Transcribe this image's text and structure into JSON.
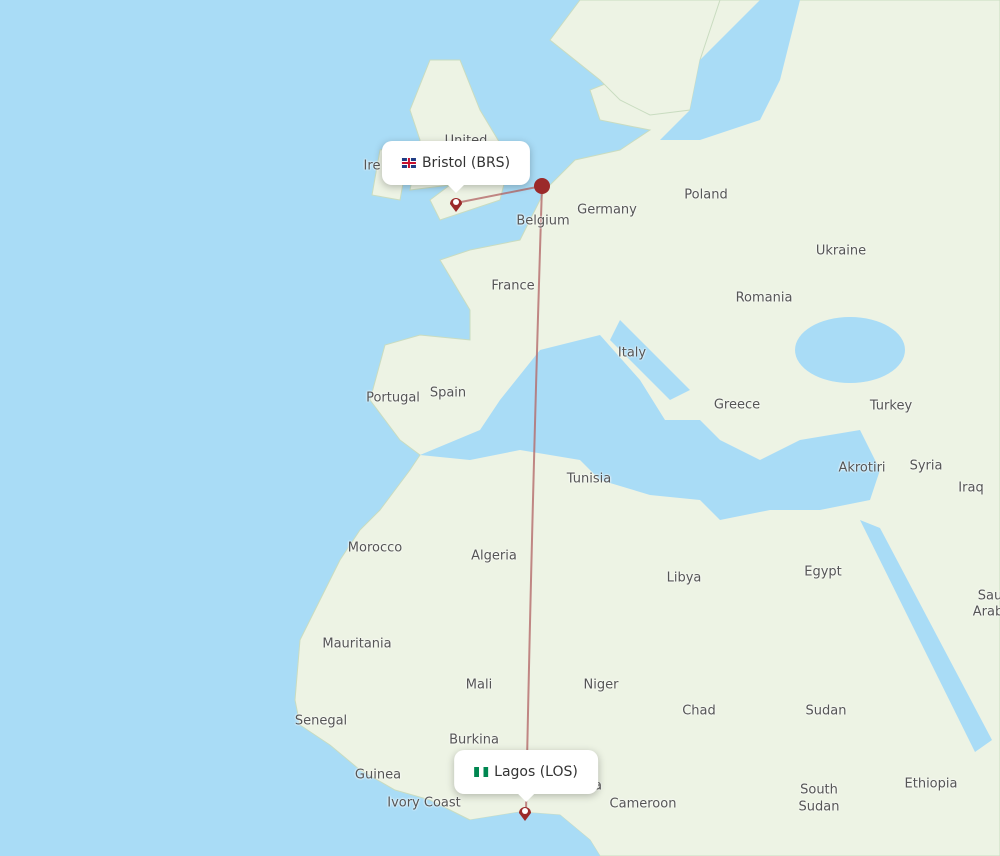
{
  "colors": {
    "water": "#a9dcf6",
    "land": "#edf3e4",
    "route": "#b46a6a",
    "marker": "#9b2a2a"
  },
  "origin": {
    "city": "Bristol (BRS)",
    "flag": "uk-flag"
  },
  "destination": {
    "city": "Lagos (LOS)",
    "flag": "nigeria-flag"
  },
  "labels": [
    "United",
    "Ire",
    "Belgium",
    "Germany",
    "Poland",
    "Ukraine",
    "France",
    "Romania",
    "Italy",
    "Portugal",
    "Spain",
    "Greece",
    "Turkey",
    "Tunisia",
    "Akrotiri",
    "Syria",
    "Iraq",
    "Morocco",
    "Algeria",
    "Libya",
    "Egypt",
    "Sau",
    "Arab",
    "Mauritania",
    "Mali",
    "Niger",
    "Chad",
    "Sudan",
    "Senegal",
    "Burkina",
    "Guinea",
    "Ivory Coast",
    "Cameroon",
    "South",
    "Sudan",
    "Ethiopia",
    "a"
  ]
}
